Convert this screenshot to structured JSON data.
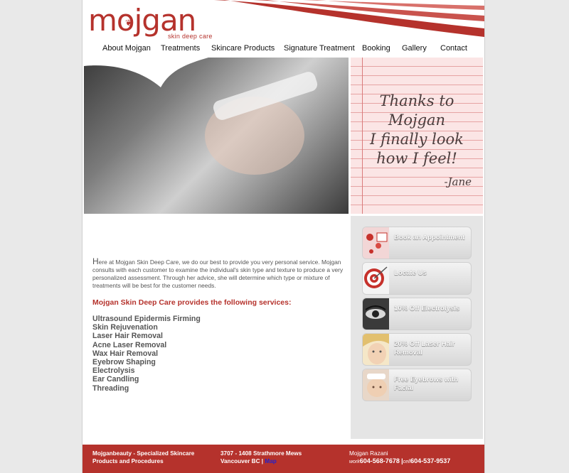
{
  "brand": {
    "name": "mojgan",
    "tagline": "skin deep care"
  },
  "nav": {
    "items": [
      "About Mojgan",
      "Treatments",
      "Skincare Products",
      "Signature Treatment",
      "Booking",
      "Gallery",
      "Contact"
    ]
  },
  "quote": {
    "lines": [
      "Thanks to",
      "Mojgan",
      "I finally look",
      "how I feel!"
    ],
    "signature": "-Jane"
  },
  "main": {
    "intro_first_letter": "H",
    "intro_rest": "ere at Mojgan Skin Deep Care, we do our best to provide you very personal service. Mojgan consults with each customer to examine the individual's skin type and texture to produce a very personalized assessment. Through her advice, she will determine which type or mixture of treatments will be best for the customer needs.",
    "services_heading": "Mojgan Skin Deep Care provides the following services:",
    "services": [
      "Ultrasound Epidermis Firming",
      "Skin Rejuvenation",
      "Laser Hair Removal",
      "Acne Laser Removal",
      "Wax Hair Removal",
      "Eyebrow Shaping",
      "Electrolysis",
      "Ear Candling",
      "Threading"
    ]
  },
  "sidebar": {
    "promos": [
      {
        "label": "Book an Appointment",
        "icon": "calendar-icon"
      },
      {
        "label": "Locate Us",
        "icon": "target-icon"
      },
      {
        "label": "10% Off Electrolysis",
        "icon": "eye-icon"
      },
      {
        "label": "20% Off Laser Hair Removal",
        "icon": "face-icon"
      },
      {
        "label": "Free Eyebrows with Facial",
        "icon": "facial-icon"
      }
    ]
  },
  "footer": {
    "company": "Mojganbeauty - Specialized Skincare Products and Procedures",
    "address_line1": "3707 - 1408 Strathmore Mews",
    "address_line2": "Vancouver BC |",
    "map_label": "Map",
    "contact_name": "Mojgan Razani",
    "work_label": "work",
    "work_phone": "604-568-7678",
    "separator": "|",
    "cell_label": "cell",
    "cell_phone": "604-537-9537"
  },
  "colors": {
    "brand_red": "#b5322c",
    "sidebar_bg": "#e5e5e5",
    "quote_paper": "#fbe5e5"
  }
}
